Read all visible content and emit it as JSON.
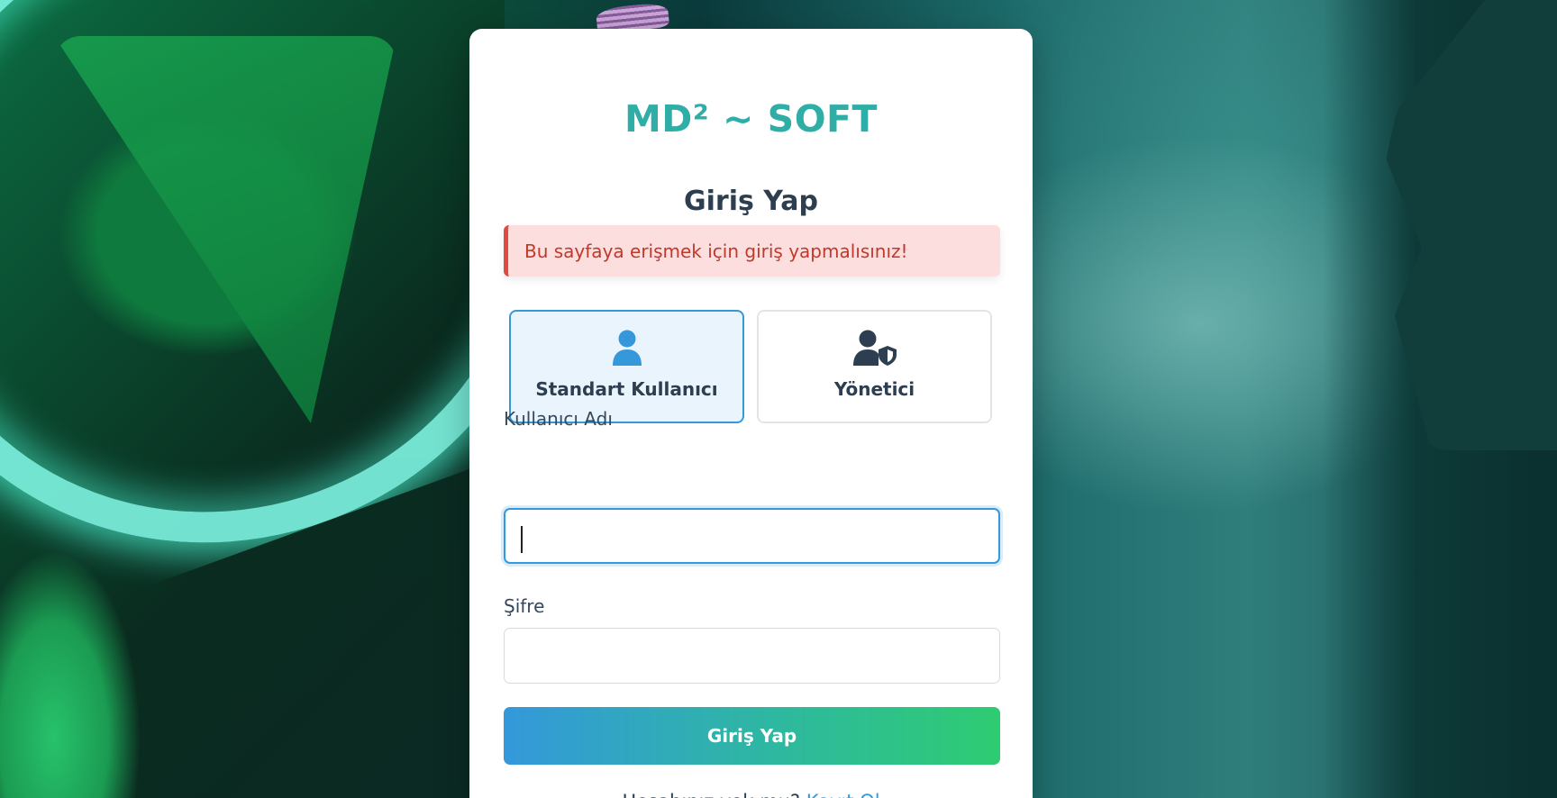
{
  "brand": "MD² ~ SOFT",
  "heading": "Giriş Yap",
  "alert": "Bu sayfaya erişmek için giriş yapmalısınız!",
  "roles": [
    {
      "label": "Standart Kullanıcı",
      "icon": "user-icon",
      "selected": true
    },
    {
      "label": "Yönetici",
      "icon": "user-shield-icon",
      "selected": false
    }
  ],
  "form": {
    "username_label": "Kullanıcı Adı",
    "username_value": "",
    "password_label": "Şifre",
    "password_value": "",
    "submit_label": "Giriş Yap"
  },
  "footer": {
    "prompt": "Hesabınız yok mu?",
    "link": "Kayıt Ol"
  },
  "colors": {
    "brand": "#2eaea6",
    "accent": "#3498db",
    "success": "#2ecc71",
    "alert_bg": "#fbdedd",
    "alert_text": "#c0392b"
  }
}
